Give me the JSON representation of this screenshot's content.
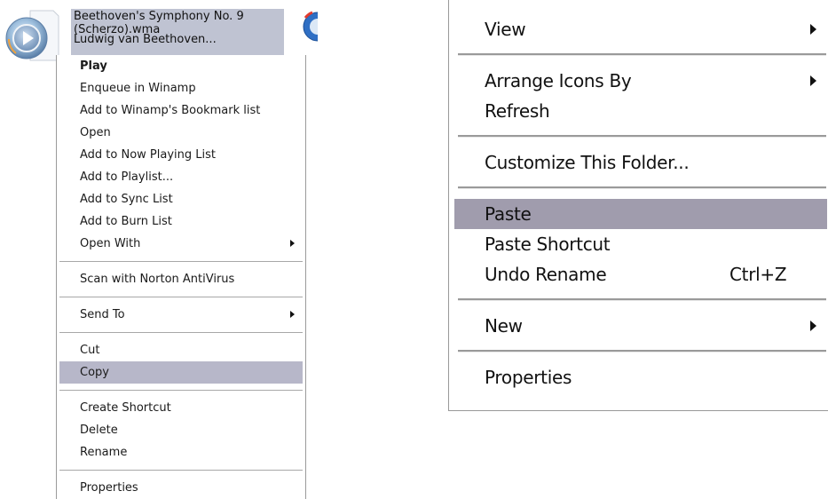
{
  "file": {
    "name_line1": "Beethoven's Symphony No. 9",
    "name_line2": "(Scherzo).wma",
    "name_line3": "Ludwig van Beethoven...",
    "icon": "windows-media-file-icon"
  },
  "left_menu": {
    "groups": [
      [
        {
          "label": "Play",
          "bold": true
        },
        {
          "label": "Enqueue in Winamp"
        },
        {
          "label": "Add to Winamp's Bookmark list"
        },
        {
          "label": "Open"
        },
        {
          "label": "Add to Now Playing List"
        },
        {
          "label": "Add to Playlist..."
        },
        {
          "label": "Add to Sync List"
        },
        {
          "label": "Add to Burn List"
        },
        {
          "label": "Open With",
          "submenu": true
        }
      ],
      [
        {
          "label": "Scan with Norton AntiVirus"
        }
      ],
      [
        {
          "label": "Send To",
          "submenu": true
        }
      ],
      [
        {
          "label": "Cut"
        },
        {
          "label": "Copy",
          "highlighted": true
        }
      ],
      [
        {
          "label": "Create Shortcut"
        },
        {
          "label": "Delete"
        },
        {
          "label": "Rename"
        }
      ],
      [
        {
          "label": "Properties"
        }
      ]
    ]
  },
  "right_menu": {
    "groups": [
      [
        {
          "label": "View",
          "submenu": true
        }
      ],
      [
        {
          "label": "Arrange Icons By",
          "submenu": true
        },
        {
          "label": "Refresh"
        }
      ],
      [
        {
          "label": "Customize This Folder..."
        }
      ],
      [
        {
          "label": "Paste",
          "highlighted": true
        },
        {
          "label": "Paste Shortcut"
        },
        {
          "label": "Undo Rename",
          "shortcut": "Ctrl+Z"
        }
      ],
      [
        {
          "label": "New",
          "submenu": true
        }
      ],
      [
        {
          "label": "Properties"
        }
      ]
    ]
  },
  "colors": {
    "highlight_left": "#b7b7c9",
    "highlight_right": "#a09cad",
    "selection_label": "#bfc3d2",
    "separator": "#a8a8a8"
  }
}
